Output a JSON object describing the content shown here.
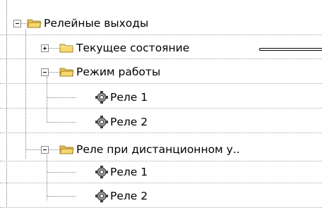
{
  "tree": {
    "relay_outputs": {
      "label": "Релейные выходы"
    },
    "current_state": {
      "label": "Текущее состояние"
    },
    "operating_mode": {
      "label": "Режим работы",
      "children": [
        {
          "label": "Реле 1"
        },
        {
          "label": "Реле 2"
        }
      ]
    },
    "remote_relay": {
      "label": "Реле при дистанционном у..",
      "children": [
        {
          "label": "Реле 1"
        },
        {
          "label": "Реле 2"
        }
      ]
    }
  },
  "icons": {
    "folder": "folder-icon",
    "relay": "gear-relay-icon",
    "expand": "plus-box",
    "collapse": "minus-box"
  },
  "colors": {
    "folder_fill": "#f6d86b",
    "folder_stroke": "#a0822e",
    "dotted_lines": "#808080",
    "row_separator": "#a8a8a8"
  }
}
